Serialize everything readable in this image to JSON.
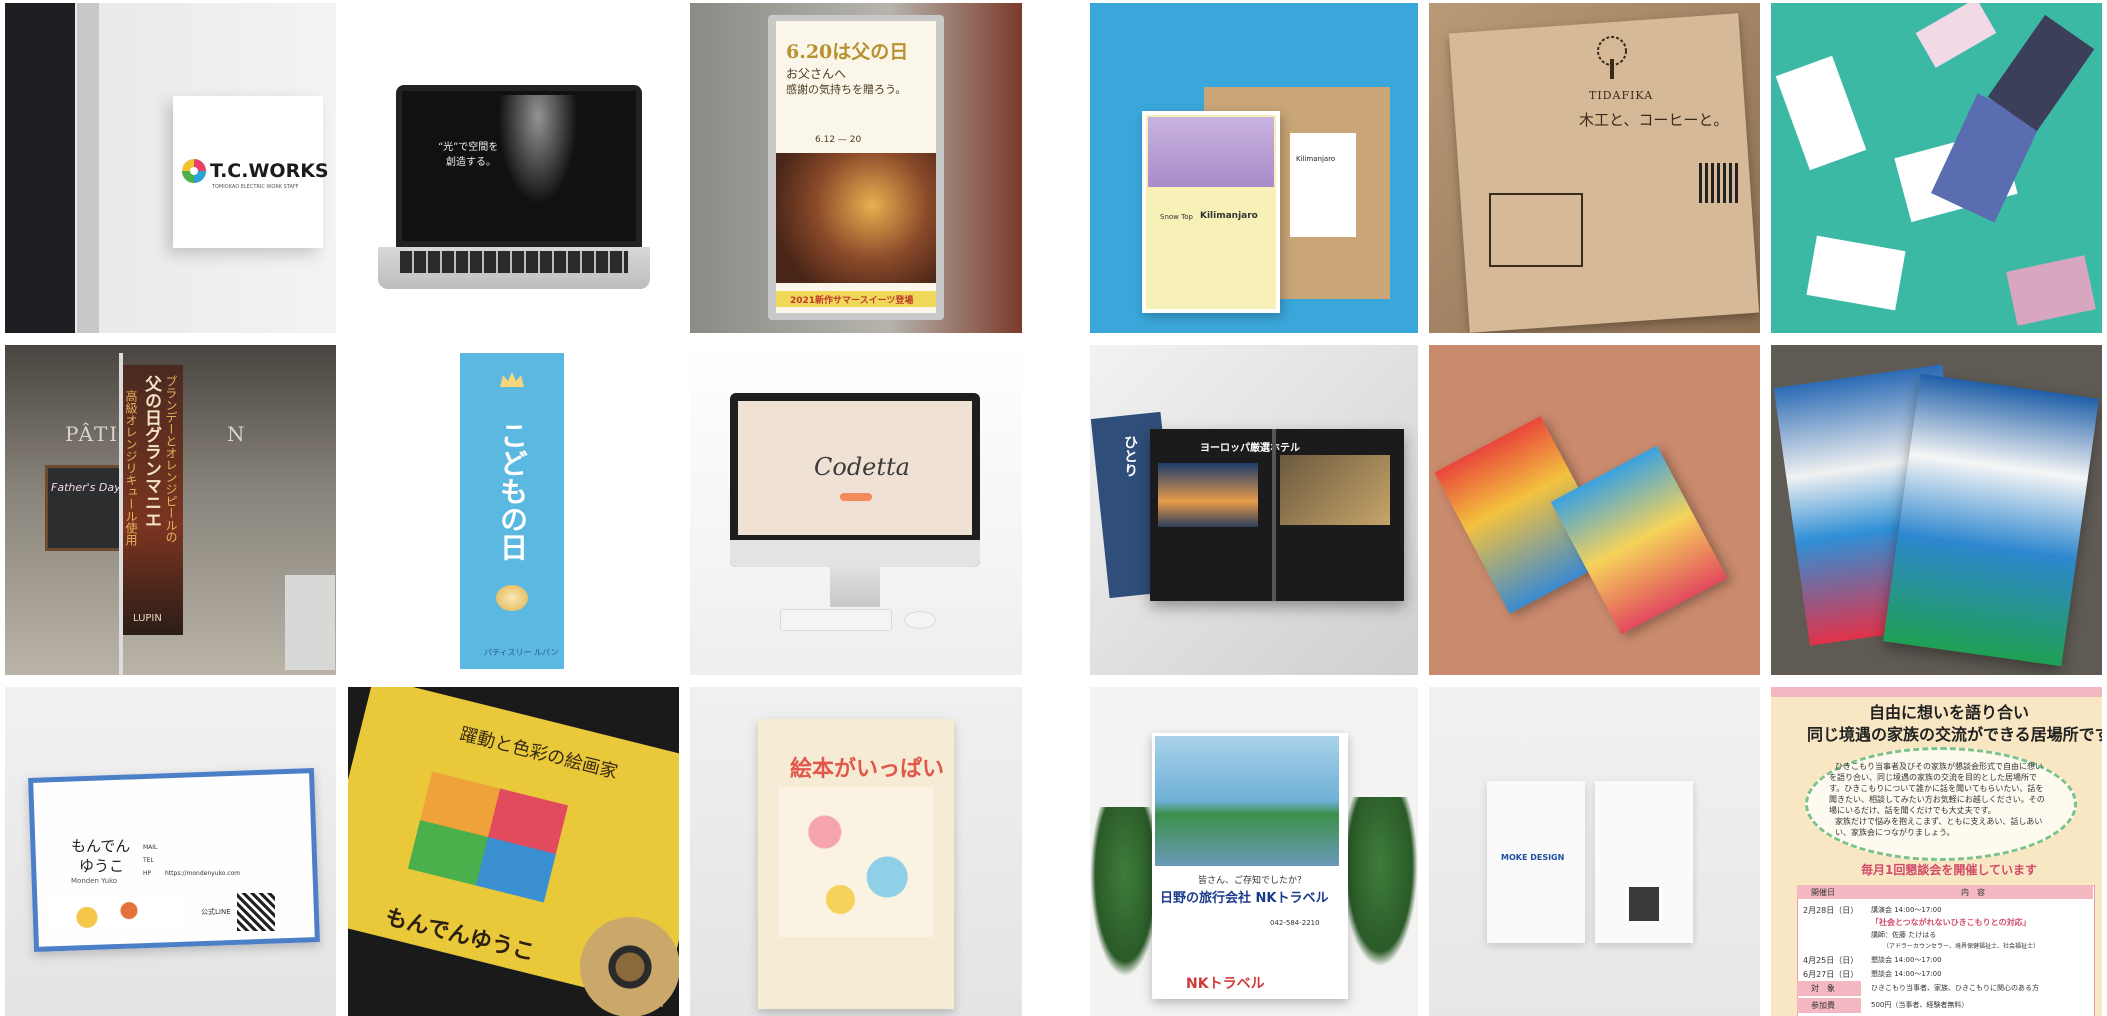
{
  "gallery": {
    "tiles": [
      {
        "texts": [
          "T.C.WORKS",
          "TOMIOKAO ELECTRIC WORK STAFF"
        ]
      },
      {
        "texts": [
          "“光”で空間を",
          "創造する。"
        ]
      },
      {
        "texts": [
          "6.20は父の日",
          "お父さんへ",
          "感謝の気持ちを贈ろう。",
          "6.12 — 20",
          "2021新作サマースイーツ登場"
        ]
      },
      {
        "texts": [
          "Kilimanjaro",
          "Snow Top",
          "Kilimanjaro"
        ]
      },
      {
        "texts": [
          "TIDAFIKA",
          "木工と、コーヒーと。"
        ]
      },
      {
        "texts": []
      },
      {
        "texts": [
          "PÂTISS",
          "N",
          "Father's Day",
          "父の日グランマニエ",
          "高級オレンジリキュール使用",
          "ブランデーとオレンジピールの",
          "LUPIN"
        ]
      },
      {
        "texts": [
          "こどもの日",
          "パティスリー ルパン"
        ]
      },
      {
        "texts": [
          "Codetta"
        ]
      },
      {
        "texts": [
          "ヨーロッパ厳選ホテル",
          "ひとり"
        ]
      },
      {
        "texts": []
      },
      {
        "texts": []
      },
      {
        "texts": [
          "もんでん",
          "ゆうこ",
          "Monden Yuko",
          "MAIL",
          "TEL",
          "HP",
          "https://mondenyuko.com",
          "公式LINE"
        ]
      },
      {
        "texts": [
          "躍動と色彩の絵画家",
          "もんでんゆうこ"
        ]
      },
      {
        "texts": [
          "絵本がいっぱい"
        ]
      },
      {
        "texts": [
          "皆さん、ご存知でしたか？",
          "日野の旅行会社 NKトラベル",
          "042-584-2210",
          "NKトラベル"
        ]
      },
      {
        "texts": [
          "MOKE DESIGN"
        ]
      },
      {
        "texts": [
          "自由に想いを語り合い",
          "同じ境遇の家族の交流ができる居場所です",
          "ひきこもり当事者及びその家族が懇談会形式で自由に想い",
          "を語り合い、同じ境遇の家族の交流を目的とした居場所で",
          "す。ひきこもりについて誰かに話を聞いてもらいたい、話を",
          "聞きたい、相談してみたい方お気軽にお越しください。その",
          "場にいるだけ、話を聞くだけでも大丈夫です。",
          "家族だけで悩みを抱えこまず、ともに支えあい、話しあい",
          "い、家族会につながりましょう。",
          "毎月1回懇談会を開催しています",
          "開催日",
          "内　容",
          "2月28日（日）",
          "講演会 14:00～17:00",
          "「社会とつながれないひきこもりとの対応」",
          "講師：佐藤 たけはる",
          "（アドラーカウンセラー、境界保健福祉士、社会福祉士）",
          "4月25日（日）",
          "懇談会 14:00～17:00",
          "6月27日（日）",
          "懇談会 14:00～17:00",
          "対　象",
          "ひきこもり当事者、家族、ひきこもりに関心のある方",
          "参加費",
          "500円（当事者、経験者無料）"
        ]
      }
    ]
  },
  "colors": {
    "accent_red": "#e8406a",
    "poster_blue": "#2aa4d6",
    "flyer_pink": "#f3b8c2"
  }
}
